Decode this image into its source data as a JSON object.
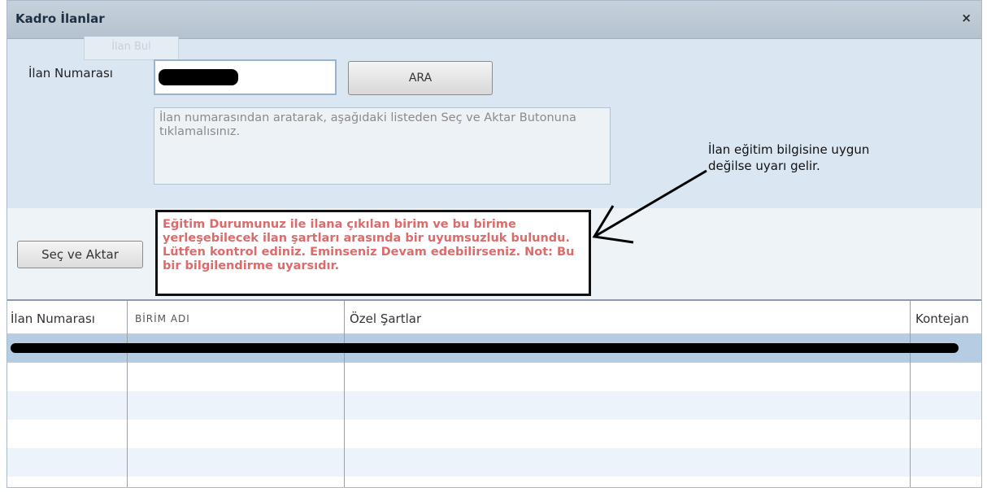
{
  "window": {
    "title": "Kadro İlanlar",
    "close_label": "×",
    "ghost_tab": "İlan Bul"
  },
  "form": {
    "ilan_label": "İlan Numarası",
    "search_button": "ARA",
    "hint": "İlan numarasından aratarak, aşağıdaki listeden Seç ve Aktar Butonuna tıklamalısınız.",
    "select_button": "Seç ve Aktar"
  },
  "warning": {
    "text": "Eğitim Durumunuz ile ilana çıkılan birim ve bu birime yerleşebilecek ilan şartları arasında bir uyumsuzluk bulundu. Lütfen kontrol ediniz. Eminseniz Devam edebilirseniz. Not: Bu bir bilgilendirme uyarsıdır."
  },
  "annotation": {
    "text": "İlan eğitim bilgisine uygun değilse uyarı gelir."
  },
  "grid": {
    "columns": [
      "İlan Numarası",
      "BİRİM ADI",
      "Özel Şartlar",
      "Kontejan"
    ]
  }
}
